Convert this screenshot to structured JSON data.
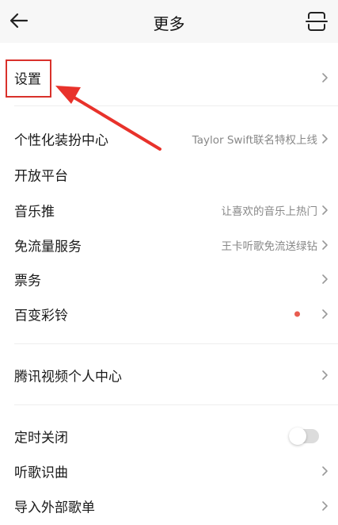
{
  "header": {
    "title": "更多",
    "back_icon": "arrow-left-icon",
    "right_icon": "scan-icon"
  },
  "items": [
    {
      "label": "设置",
      "right_text": ""
    },
    {
      "label": "个性化装扮中心",
      "right_text": "Taylor Swift联名特权上线"
    },
    {
      "label": "开放平台",
      "right_text": ""
    },
    {
      "label": "音乐推",
      "right_text": "让喜欢的音乐上热门"
    },
    {
      "label": "免流量服务",
      "right_text": "王卡听歌免流送绿钻"
    },
    {
      "label": "票务",
      "right_text": ""
    },
    {
      "label": "百变彩铃",
      "right_text": ""
    },
    {
      "label": "腾讯视频个人中心",
      "right_text": ""
    },
    {
      "label": "定时关闭",
      "right_text": ""
    },
    {
      "label": "听歌识曲",
      "right_text": ""
    },
    {
      "label": "导入外部歌单",
      "right_text": ""
    }
  ],
  "timer_toggle": {
    "enabled": false
  },
  "colors": {
    "annotation": "#d9312b",
    "badge_dot": "#e85c4f",
    "header_bg": "#f7f7f7"
  }
}
